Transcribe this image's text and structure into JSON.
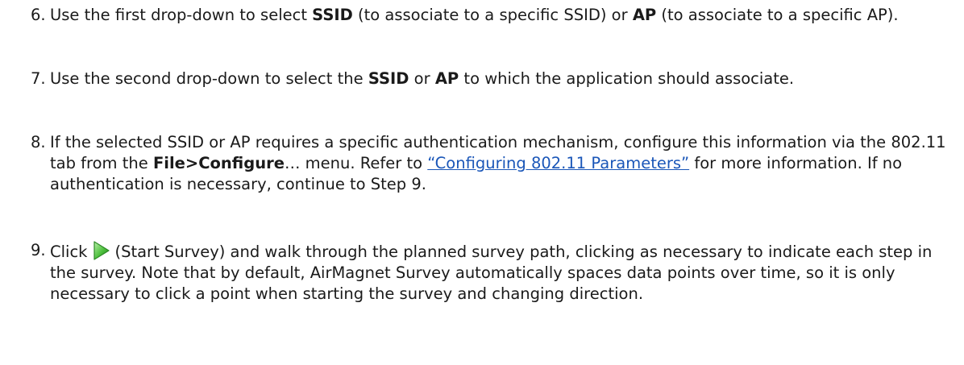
{
  "steps": [
    {
      "num": "6.",
      "t1": "Use the first drop-down to select ",
      "b1": "SSID",
      "t2": " (to associate to a specific SSID) or ",
      "b2": "AP",
      "t3": " (to associate to a specific AP)."
    },
    {
      "num": "7.",
      "t1": "Use the second drop-down to select the ",
      "b1": "SSID",
      "t2": " or ",
      "b2": "AP",
      "t3": " to which the application should associate."
    },
    {
      "num": "8.",
      "t1": "If the selected SSID or AP requires a specific authentication mechanism, configure this information via the 802.11 tab from the ",
      "b1": "File>Configure",
      "t2": "… menu. Refer to ",
      "link": "“Configuring 802.11 Parameters”",
      "t3": " for more information. If no authentication is necessary, continue to Step 9."
    },
    {
      "num": "9.",
      "t1": "Click",
      "icon": "start-survey-play-icon",
      "t2": "(Start Survey) and walk through the planned survey path, clicking as necessary to indicate each step in the survey. Note that by default, AirMagnet Survey automatically spaces data points over time, so it is only necessary to click a point when starting the survey and changing direction."
    }
  ],
  "colors": {
    "text": "#1a1a1a",
    "link": "#1a56b8",
    "icon_green": "#3aa534"
  }
}
